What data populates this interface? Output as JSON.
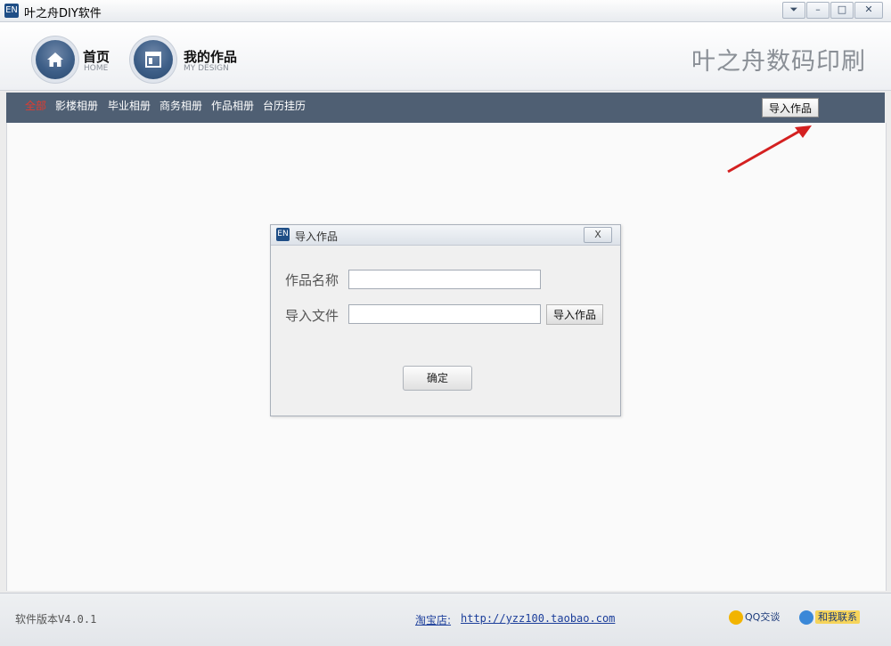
{
  "window": {
    "icon_text": "EN",
    "title": "叶之舟DIY软件",
    "controls": [
      "⏷",
      "–",
      "□",
      "✕"
    ]
  },
  "header": {
    "nav": [
      {
        "label": "首页",
        "sub": "HOME"
      },
      {
        "label": "我的作品",
        "sub": "MY DESIGN"
      }
    ],
    "brand": "叶之舟数码印刷"
  },
  "categories": {
    "items": [
      "全部",
      "影楼相册",
      "毕业相册",
      "商务相册",
      "作品相册",
      "台历挂历"
    ],
    "active_index": 0,
    "import_button": "导入作品"
  },
  "dialog": {
    "icon_text": "EN",
    "title": "导入作品",
    "close": "X",
    "name_label": "作品名称",
    "name_value": "",
    "file_label": "导入文件",
    "file_value": "",
    "browse_button": "导入作品",
    "ok_button": "确定"
  },
  "status": {
    "version": "软件版本V4.0.1",
    "shop_label": "淘宝店:",
    "shop_url": "http://yzz100.taobao.com",
    "qq_button": "QQ交谈",
    "contact_button": "和我联系"
  },
  "colors": {
    "category_bar": "#4f5f73",
    "active_category": "#e23b2e",
    "arrow": "#d42020"
  }
}
